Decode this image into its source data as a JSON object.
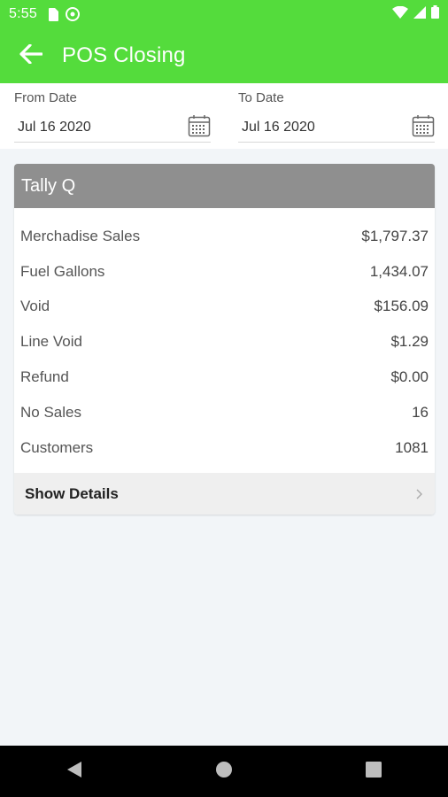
{
  "status_bar": {
    "time": "5:55"
  },
  "app_bar": {
    "title": "POS Closing"
  },
  "filters": {
    "from_label": "From Date",
    "from_value": "Jul 16 2020",
    "to_label": "To Date",
    "to_value": "Jul 16 2020"
  },
  "card": {
    "title": "Tally Q",
    "rows": [
      {
        "label": "Merchadise Sales",
        "value": "$1,797.37"
      },
      {
        "label": "Fuel Gallons",
        "value": "1,434.07"
      },
      {
        "label": "Void",
        "value": "$156.09"
      },
      {
        "label": "Line Void",
        "value": "$1.29"
      },
      {
        "label": "Refund",
        "value": "$0.00"
      },
      {
        "label": "No Sales",
        "value": "16"
      },
      {
        "label": "Customers",
        "value": "1081"
      }
    ],
    "details_label": "Show Details"
  },
  "colors": {
    "app_bar": "#54dc3c",
    "card_header": "#8f8f8f",
    "background": "#f2f5f8"
  },
  "icons": {
    "back": "arrow-left-icon",
    "calendar": "calendar-icon",
    "chevron": "chevron-right-icon"
  }
}
